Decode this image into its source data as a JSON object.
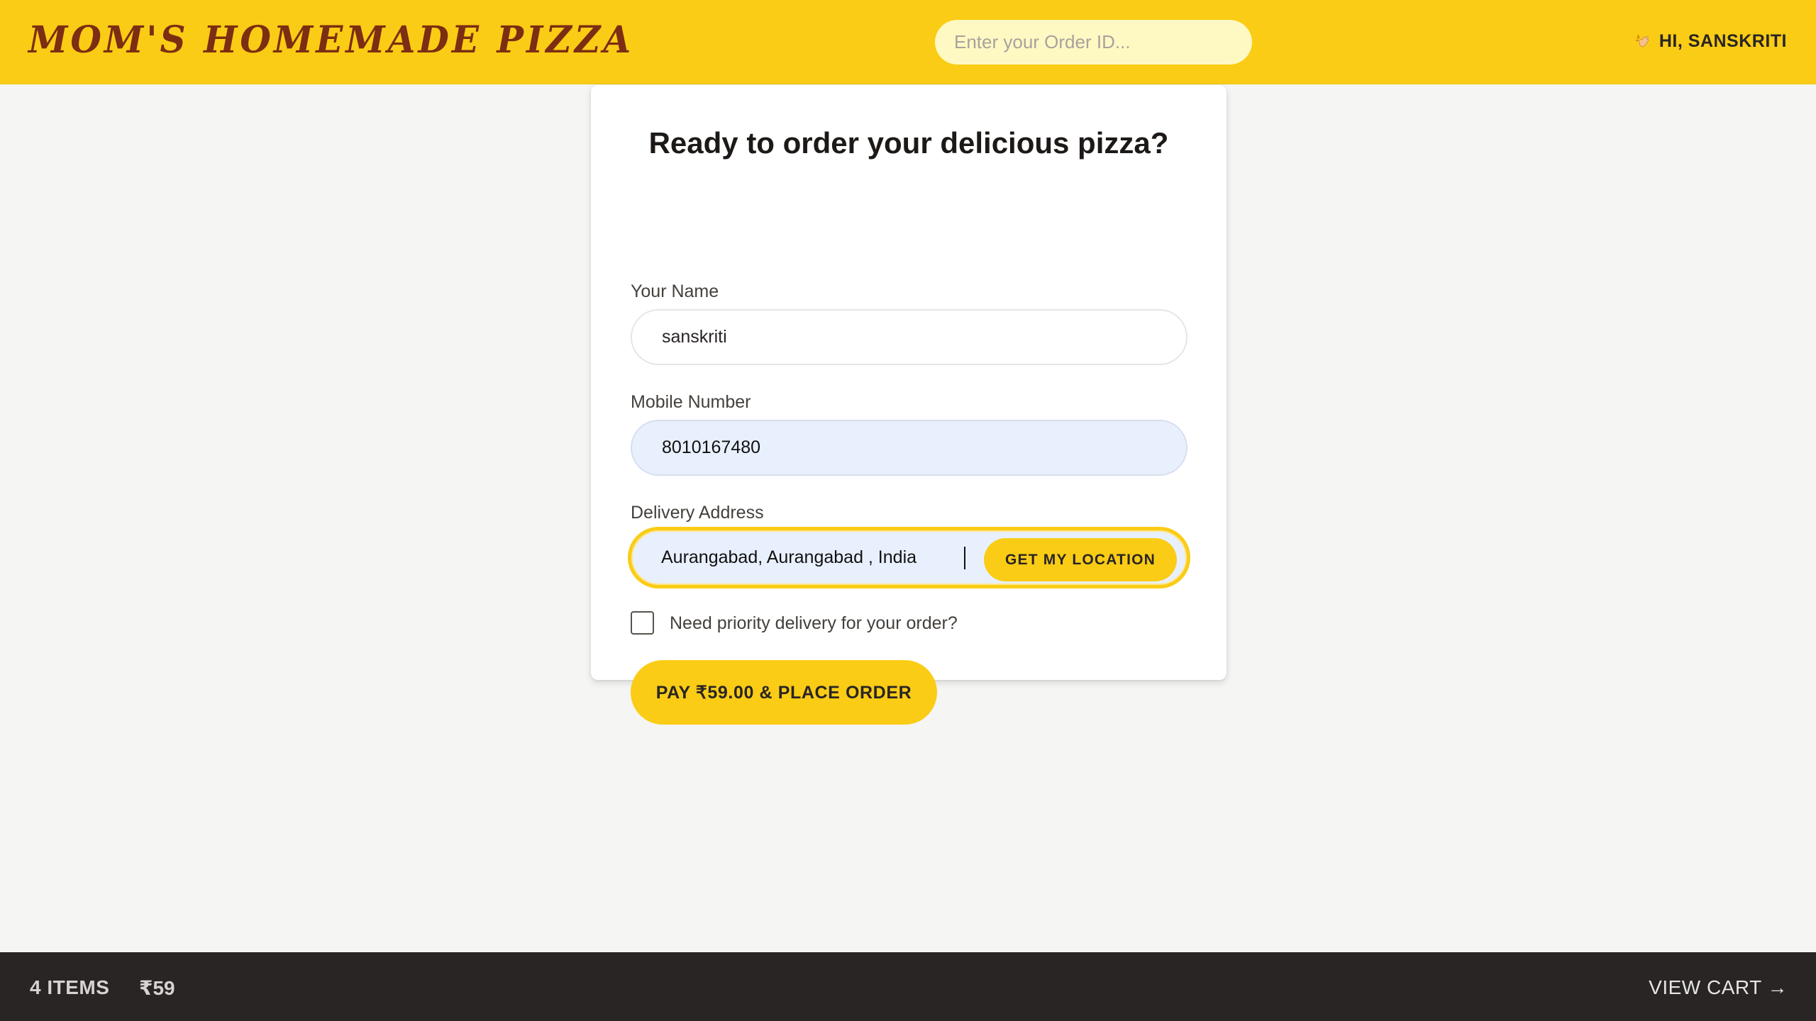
{
  "header": {
    "logo": "MOM'S HOMEMADE PIZZA",
    "search_placeholder": "Enter your Order ID...",
    "greeting": "HI, SANSKRITI",
    "greeting_icon": "waving-hand-icon"
  },
  "form": {
    "title": "Ready to order your delicious pizza?",
    "name_label": "Your Name",
    "name_value": "sanskriti",
    "phone_label": "Mobile Number",
    "phone_value": "8010167480",
    "address_label": "Delivery Address",
    "address_value": "Aurangabad, Aurangabad , India",
    "location_button": "GET MY LOCATION",
    "priority_label": "Need priority delivery for your order?",
    "priority_checked": false,
    "pay_button": "PAY ₹59.00 & PLACE ORDER"
  },
  "footer": {
    "items": "4 ITEMS",
    "total": "₹59",
    "view_cart": "VIEW CART →"
  },
  "colors": {
    "brand_yellow": "#facc15",
    "logo_brown": "#7c2d12",
    "footer_dark": "#292524",
    "page_bg": "#f5f5f4"
  }
}
